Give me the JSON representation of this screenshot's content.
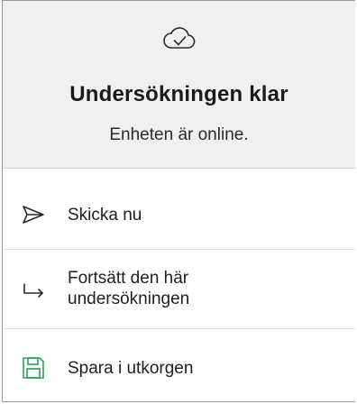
{
  "header": {
    "icon": "cloud-check-icon",
    "title": "Undersökningen klar",
    "subtitle": "Enheten är online."
  },
  "actions": [
    {
      "icon": "send-icon",
      "label_lines": [
        "Skicka nu"
      ]
    },
    {
      "icon": "return-arrow-icon",
      "label_lines": [
        "Fortsätt den här",
        "undersökningen"
      ]
    },
    {
      "icon": "save-floppy-icon",
      "label_lines": [
        "Spara i utkorgen"
      ]
    }
  ],
  "colors": {
    "header_bg": "#f0f0f0",
    "save_icon": "#2e9e5b",
    "text": "#1f1f1f"
  }
}
